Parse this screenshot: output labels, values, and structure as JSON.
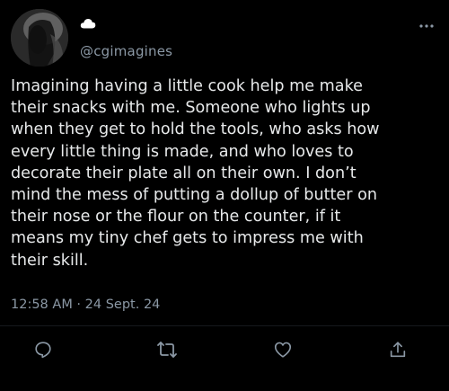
{
  "tweet": {
    "handle": "@cgimagines",
    "name_emoji_icon": "cloud-icon",
    "text": "Imagining having a little cook help me make\ntheir snacks with me. Someone who lights up\nwhen they get to hold the tools, who asks how\nevery little thing is made, and who loves to\ndecorate their plate all on their own. I don’t\nmind the mess of putting a dollup of butter on\ntheir nose or the flour on the counter, if it\nmeans my tiny chef gets to impress me with\ntheir skill.",
    "timestamp": "12:58 AM · 24 Sept. 24"
  },
  "actions": [
    {
      "icon": "reply-icon"
    },
    {
      "icon": "retweet-icon"
    },
    {
      "icon": "like-icon"
    },
    {
      "icon": "share-icon"
    }
  ],
  "colors": {
    "background": "#000000",
    "text": "#e7e9ea",
    "secondary_text": "#8b98a5",
    "icon": "#8b98a5"
  }
}
